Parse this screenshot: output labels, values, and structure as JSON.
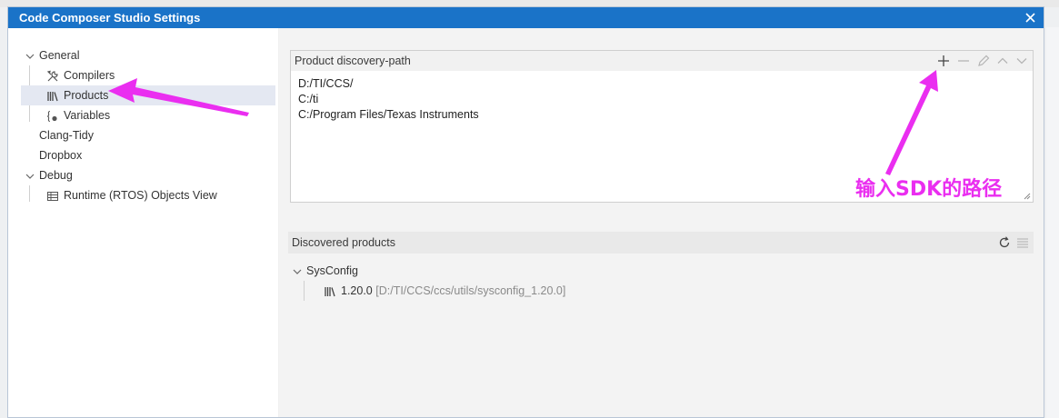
{
  "window": {
    "title": "Code Composer Studio Settings"
  },
  "sidebar": {
    "items": [
      {
        "label": "General"
      },
      {
        "label": "Compilers"
      },
      {
        "label": "Products"
      },
      {
        "label": "Variables"
      },
      {
        "label": "Clang-Tidy"
      },
      {
        "label": "Dropbox"
      },
      {
        "label": "Debug"
      },
      {
        "label": "Runtime (RTOS) Objects View"
      }
    ],
    "selected": "Products"
  },
  "discovery_path": {
    "title": "Product discovery-path",
    "paths": [
      "D:/TI/CCS/",
      "C:/ti",
      "C:/Program Files/Texas Instruments"
    ],
    "toolbar_icons": [
      "plus-icon",
      "minus-icon",
      "pencil-icon",
      "chevron-up-icon",
      "chevron-down-icon"
    ]
  },
  "discovered": {
    "title": "Discovered products",
    "toolbar_icons": [
      "refresh-icon",
      "list-icon"
    ],
    "products": [
      {
        "name": "SysConfig",
        "versions": [
          {
            "version": "1.20.0",
            "path": "[D:/TI/CCS/ccs/utils/sysconfig_1.20.0]"
          }
        ]
      }
    ]
  },
  "annotation": {
    "text": "输入SDK的路径",
    "color": "#ea2ef0"
  },
  "colors": {
    "titlebar": "#1a73c8",
    "selection": "#e4e8f2",
    "annotation": "#ea2ef0"
  }
}
